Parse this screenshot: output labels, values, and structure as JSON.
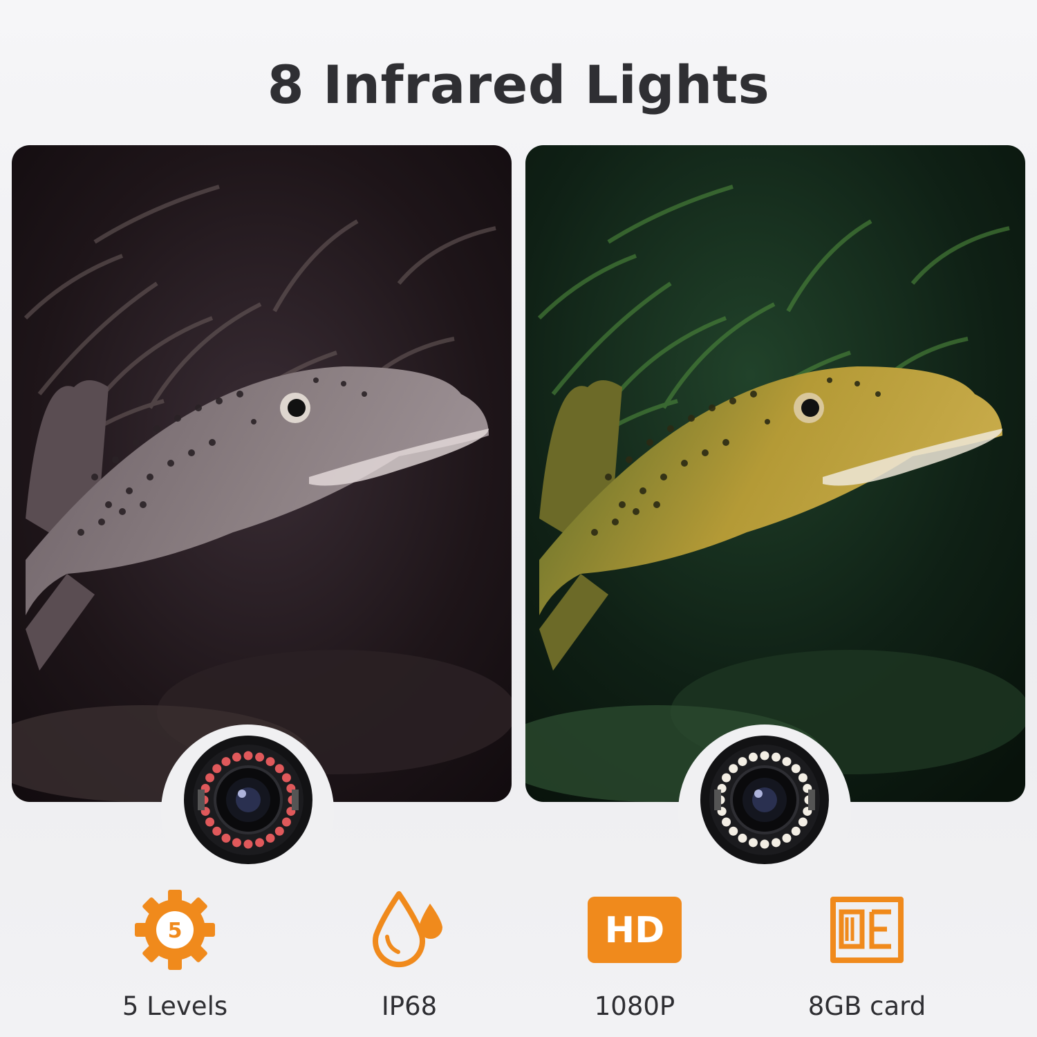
{
  "title": "8 Infrared Lights",
  "accent_color": "#f08a1c",
  "panels": [
    {
      "name": "infrared-view",
      "tone": "dark-mauve",
      "led_color": "#e0595b"
    },
    {
      "name": "daylight-view",
      "tone": "green",
      "led_color": "#f3eee4"
    }
  ],
  "features": [
    {
      "icon": "gear-icon",
      "icon_text": "5",
      "label": "5 Levels"
    },
    {
      "icon": "water-drop-icon",
      "label": "IP68"
    },
    {
      "icon": "hd-icon",
      "icon_text": "HD",
      "label": "1080P"
    },
    {
      "icon": "sd-card-icon",
      "label": "8GB card"
    }
  ]
}
